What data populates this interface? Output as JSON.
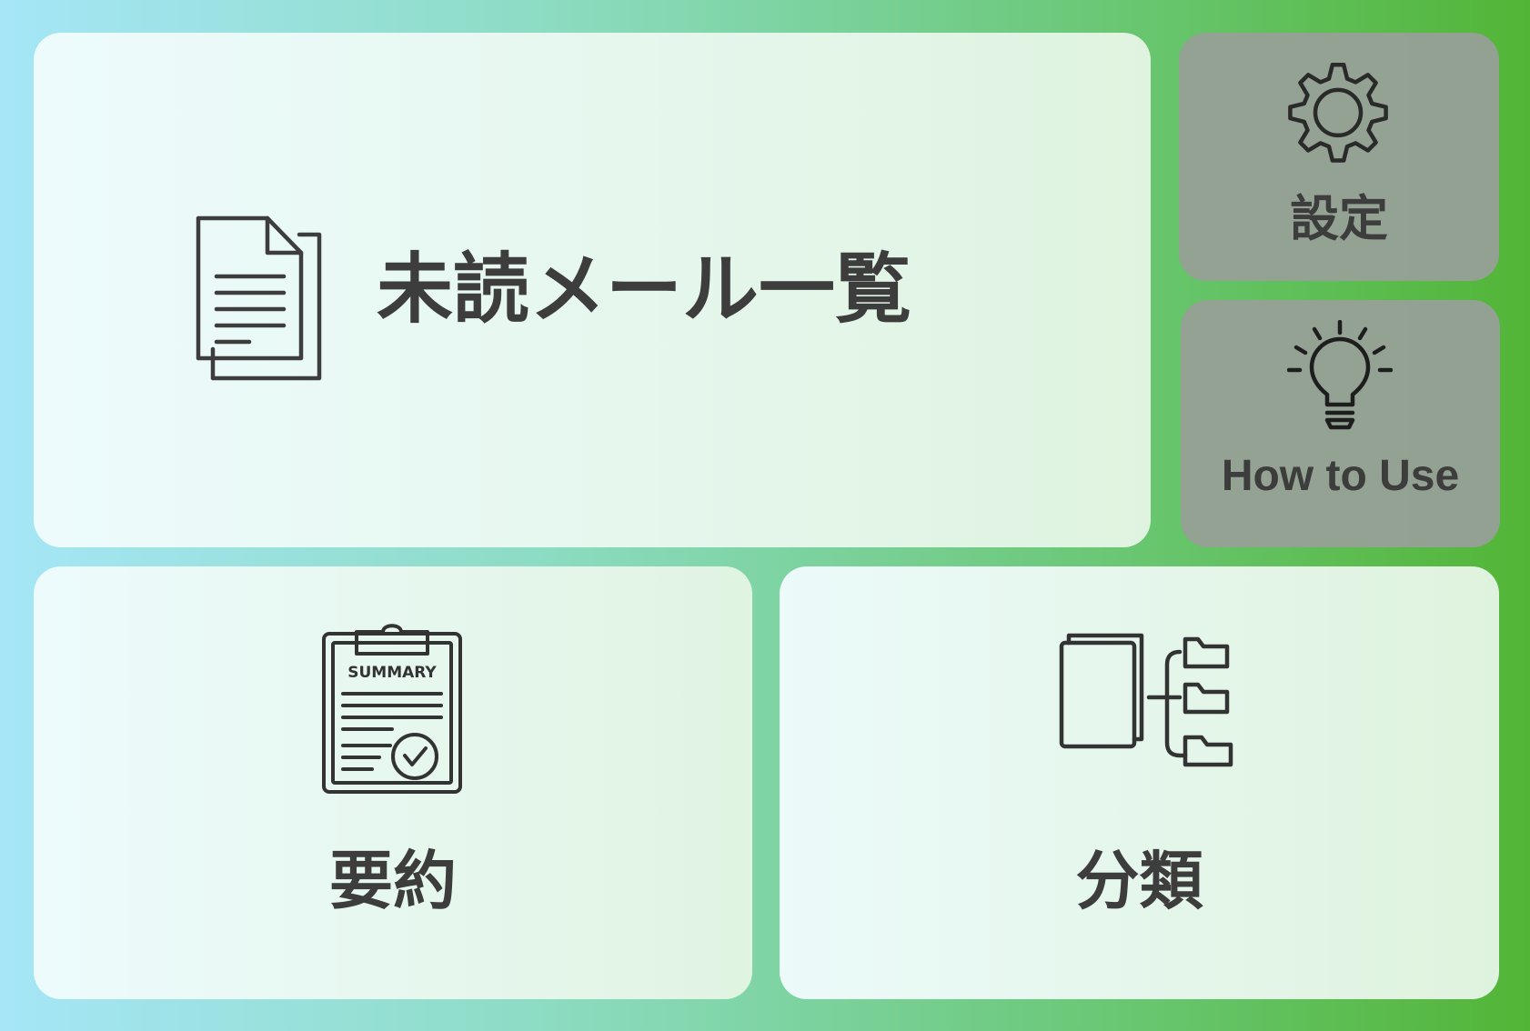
{
  "tiles": {
    "unread": {
      "label": "未読メール一覧",
      "icon": "document-icon"
    },
    "settings": {
      "label": "設定",
      "icon": "gear-icon"
    },
    "howto": {
      "label": "How to Use",
      "icon": "lightbulb-icon"
    },
    "summary": {
      "label": "要約",
      "icon": "clipboard-summary-icon",
      "icon_text": "SUMMARY"
    },
    "classify": {
      "label": "分類",
      "icon": "folder-tree-icon"
    }
  },
  "colors": {
    "text": "#3d3d3d",
    "gradient_left": "#a6e6f7",
    "gradient_right": "#52b536",
    "card_light": "#eef9f3",
    "card_gray": "#96a096"
  }
}
